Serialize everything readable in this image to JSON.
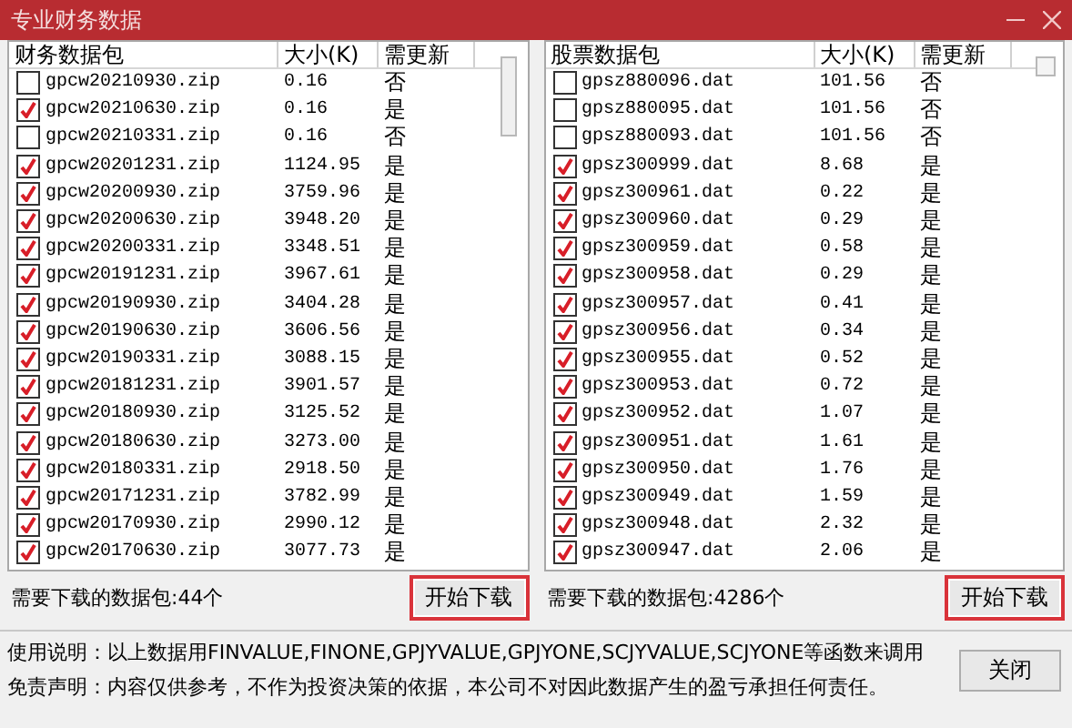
{
  "window": {
    "title": "专业财务数据"
  },
  "panels": [
    {
      "columns": [
        "财务数据包",
        "大小(K)",
        "需更新"
      ],
      "rows": [
        {
          "name": "gpcw20210930.zip",
          "size": "0.16",
          "update": "否",
          "checked": false
        },
        {
          "name": "gpcw20210630.zip",
          "size": "0.16",
          "update": "是",
          "checked": true
        },
        {
          "name": "gpcw20210331.zip",
          "size": "0.16",
          "update": "否",
          "checked": false
        },
        {
          "name": "gpcw20201231.zip",
          "size": "1124.95",
          "update": "是",
          "checked": true
        },
        {
          "name": "gpcw20200930.zip",
          "size": "3759.96",
          "update": "是",
          "checked": true
        },
        {
          "name": "gpcw20200630.zip",
          "size": "3948.20",
          "update": "是",
          "checked": true
        },
        {
          "name": "gpcw20200331.zip",
          "size": "3348.51",
          "update": "是",
          "checked": true
        },
        {
          "name": "gpcw20191231.zip",
          "size": "3967.61",
          "update": "是",
          "checked": true
        },
        {
          "name": "gpcw20190930.zip",
          "size": "3404.28",
          "update": "是",
          "checked": true
        },
        {
          "name": "gpcw20190630.zip",
          "size": "3606.56",
          "update": "是",
          "checked": true
        },
        {
          "name": "gpcw20190331.zip",
          "size": "3088.15",
          "update": "是",
          "checked": true
        },
        {
          "name": "gpcw20181231.zip",
          "size": "3901.57",
          "update": "是",
          "checked": true
        },
        {
          "name": "gpcw20180930.zip",
          "size": "3125.52",
          "update": "是",
          "checked": true
        },
        {
          "name": "gpcw20180630.zip",
          "size": "3273.00",
          "update": "是",
          "checked": true
        },
        {
          "name": "gpcw20180331.zip",
          "size": "2918.50",
          "update": "是",
          "checked": true
        },
        {
          "name": "gpcw20171231.zip",
          "size": "3782.99",
          "update": "是",
          "checked": true
        },
        {
          "name": "gpcw20170930.zip",
          "size": "2990.12",
          "update": "是",
          "checked": true
        },
        {
          "name": "gpcw20170630.zip",
          "size": "3077.73",
          "update": "是",
          "checked": true
        }
      ],
      "count_label": "需要下载的数据包:44个",
      "button": {
        "label": "开始下载",
        "highlighted": true
      }
    },
    {
      "columns": [
        "股票数据包",
        "大小(K)",
        "需更新"
      ],
      "rows": [
        {
          "name": "gpsz880096.dat",
          "size": "101.56",
          "update": "否",
          "checked": false
        },
        {
          "name": "gpsz880095.dat",
          "size": "101.56",
          "update": "否",
          "checked": false
        },
        {
          "name": "gpsz880093.dat",
          "size": "101.56",
          "update": "否",
          "checked": false
        },
        {
          "name": "gpsz300999.dat",
          "size": "8.68",
          "update": "是",
          "checked": true
        },
        {
          "name": "gpsz300961.dat",
          "size": "0.22",
          "update": "是",
          "checked": true
        },
        {
          "name": "gpsz300960.dat",
          "size": "0.29",
          "update": "是",
          "checked": true
        },
        {
          "name": "gpsz300959.dat",
          "size": "0.58",
          "update": "是",
          "checked": true
        },
        {
          "name": "gpsz300958.dat",
          "size": "0.29",
          "update": "是",
          "checked": true
        },
        {
          "name": "gpsz300957.dat",
          "size": "0.41",
          "update": "是",
          "checked": true
        },
        {
          "name": "gpsz300956.dat",
          "size": "0.34",
          "update": "是",
          "checked": true
        },
        {
          "name": "gpsz300955.dat",
          "size": "0.52",
          "update": "是",
          "checked": true
        },
        {
          "name": "gpsz300953.dat",
          "size": "0.72",
          "update": "是",
          "checked": true
        },
        {
          "name": "gpsz300952.dat",
          "size": "1.07",
          "update": "是",
          "checked": true
        },
        {
          "name": "gpsz300951.dat",
          "size": "1.61",
          "update": "是",
          "checked": true
        },
        {
          "name": "gpsz300950.dat",
          "size": "1.76",
          "update": "是",
          "checked": true
        },
        {
          "name": "gpsz300949.dat",
          "size": "1.59",
          "update": "是",
          "checked": true
        },
        {
          "name": "gpsz300948.dat",
          "size": "2.32",
          "update": "是",
          "checked": true
        },
        {
          "name": "gpsz300947.dat",
          "size": "2.06",
          "update": "是",
          "checked": true
        }
      ],
      "count_label": "需要下载的数据包:4286个",
      "button": {
        "label": "开始下载",
        "highlighted": true
      }
    }
  ],
  "footer": {
    "usage": "使用说明：以上数据用FINVALUE,FINONE,GPJYVALUE,GPJYONE,SCJYVALUE,SCJYONE等函数来调用",
    "disclaimer": "免责声明：内容仅供参考，不作为投资决策的依据，本公司不对因此数据产生的盈亏承担任何责任。",
    "close_button": {
      "label": "关闭",
      "highlighted": false
    }
  }
}
